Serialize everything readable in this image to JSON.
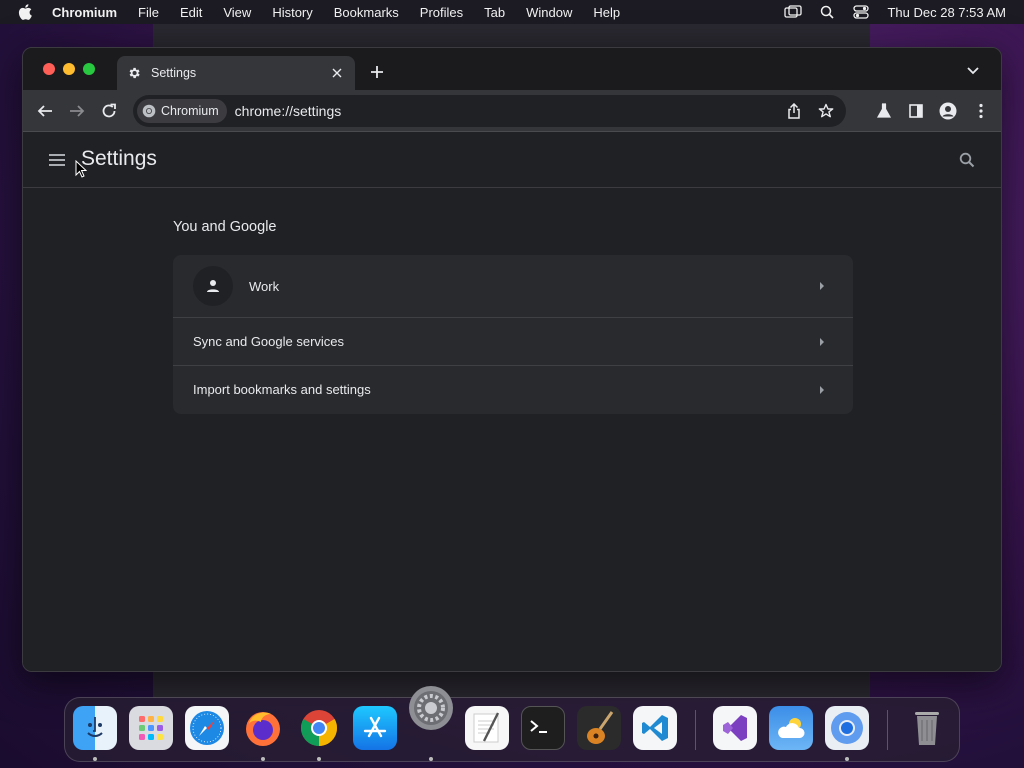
{
  "menubar": {
    "app_name": "Chromium",
    "items": [
      "File",
      "Edit",
      "View",
      "History",
      "Bookmarks",
      "Profiles",
      "Tab",
      "Window",
      "Help"
    ],
    "clock": "Thu Dec 28  7:53 AM"
  },
  "tab": {
    "title": "Settings",
    "icon": "gear-icon"
  },
  "omnibox": {
    "chip_label": "Chromium",
    "url": "chrome://settings"
  },
  "settings": {
    "title": "Settings",
    "section_title": "You and Google",
    "rows": {
      "profile_name": "Work",
      "sync_label": "Sync and Google services",
      "import_label": "Import bookmarks and settings"
    }
  },
  "dock": {
    "apps": [
      "Finder",
      "Launchpad",
      "Safari",
      "Firefox",
      "Chrome",
      "App Store",
      "System Preferences",
      "TextEdit",
      "Terminal",
      "GarageBand",
      "Visual Studio Code",
      "Visual Studio",
      "Weather",
      "Chromium",
      "Trash"
    ]
  },
  "colors": {
    "page_bg": "#202124",
    "card_bg": "#292a2d",
    "toolbar_bg": "#35363a",
    "text": "#e8eaed"
  }
}
